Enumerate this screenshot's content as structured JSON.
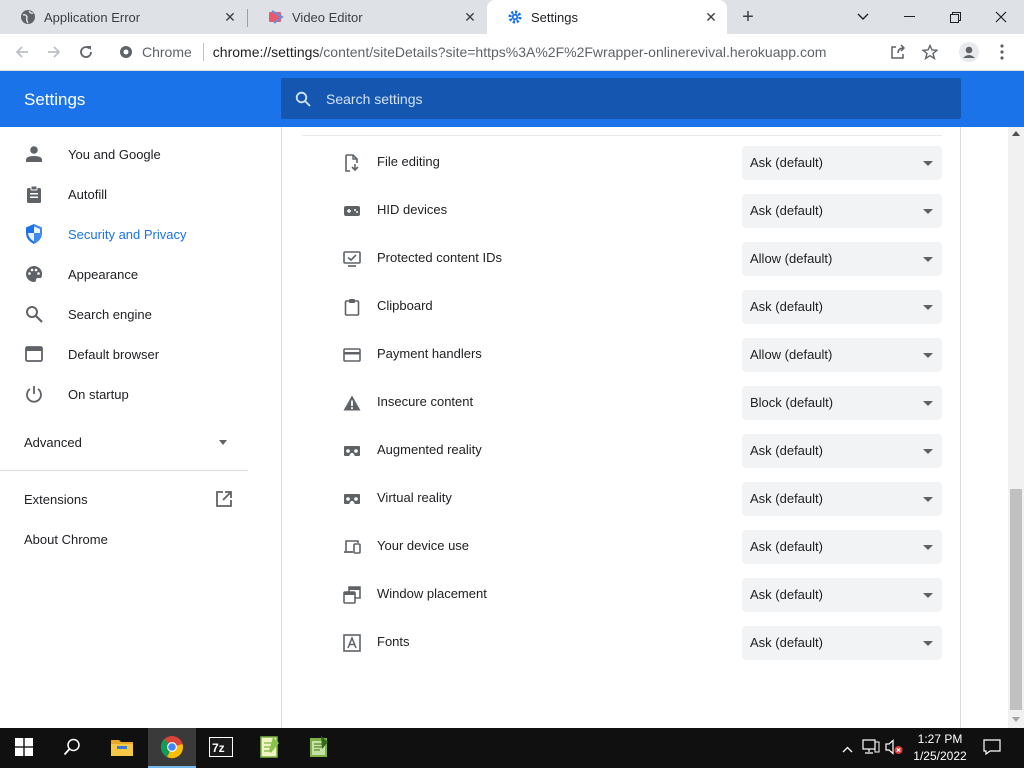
{
  "tabs": [
    {
      "title": "Application Error",
      "icon": "globe-icon",
      "active": false
    },
    {
      "title": "Video Editor",
      "icon": "video-editor-icon",
      "active": false
    },
    {
      "title": "Settings",
      "icon": "gear-icon",
      "active": true
    }
  ],
  "toolbar": {
    "site_chip": "Chrome",
    "url_host": "chrome://settings",
    "url_path": "/content/siteDetails?site=https%3A%2F%2Fwrapper-onlinerevival.herokuapp.com"
  },
  "header": {
    "title": "Settings",
    "search_placeholder": "Search settings"
  },
  "sidebar": {
    "items": [
      {
        "label": "You and Google",
        "icon": "person-icon",
        "active": false
      },
      {
        "label": "Autofill",
        "icon": "clipboard-icon",
        "active": false
      },
      {
        "label": "Security and Privacy",
        "icon": "shield-icon",
        "active": true
      },
      {
        "label": "Appearance",
        "icon": "palette-icon",
        "active": false
      },
      {
        "label": "Search engine",
        "icon": "search-icon",
        "active": false
      },
      {
        "label": "Default browser",
        "icon": "browser-window-icon",
        "active": false
      },
      {
        "label": "On startup",
        "icon": "power-icon",
        "active": false
      }
    ],
    "advanced_label": "Advanced",
    "extensions_label": "Extensions",
    "about_label": "About Chrome"
  },
  "permissions": [
    {
      "label": "File editing",
      "value": "Ask (default)",
      "icon": "file-edit-icon"
    },
    {
      "label": "HID devices",
      "value": "Ask (default)",
      "icon": "gamepad-icon"
    },
    {
      "label": "Protected content IDs",
      "value": "Allow (default)",
      "icon": "monitor-check-icon"
    },
    {
      "label": "Clipboard",
      "value": "Ask (default)",
      "icon": "clipboard-icon"
    },
    {
      "label": "Payment handlers",
      "value": "Allow (default)",
      "icon": "credit-card-icon"
    },
    {
      "label": "Insecure content",
      "value": "Block (default)",
      "icon": "warning-icon"
    },
    {
      "label": "Augmented reality",
      "value": "Ask (default)",
      "icon": "vr-headset-icon"
    },
    {
      "label": "Virtual reality",
      "value": "Ask (default)",
      "icon": "vr-headset-icon"
    },
    {
      "label": "Your device use",
      "value": "Ask (default)",
      "icon": "devices-icon"
    },
    {
      "label": "Window placement",
      "value": "Ask (default)",
      "icon": "window-placement-icon"
    },
    {
      "label": "Fonts",
      "value": "Ask (default)",
      "icon": "font-icon"
    }
  ],
  "taskbar": {
    "time": "1:27 PM",
    "date": "1/25/2022",
    "apps": [
      "file-explorer-icon",
      "chrome-icon",
      "7zip-icon",
      "notepad-plus-icon",
      "notepad-green-icon"
    ]
  },
  "colors": {
    "accent": "#1a73e8",
    "search_bg": "#1557b0",
    "select_bg": "#f1f3f4",
    "taskbar": "#101010"
  }
}
